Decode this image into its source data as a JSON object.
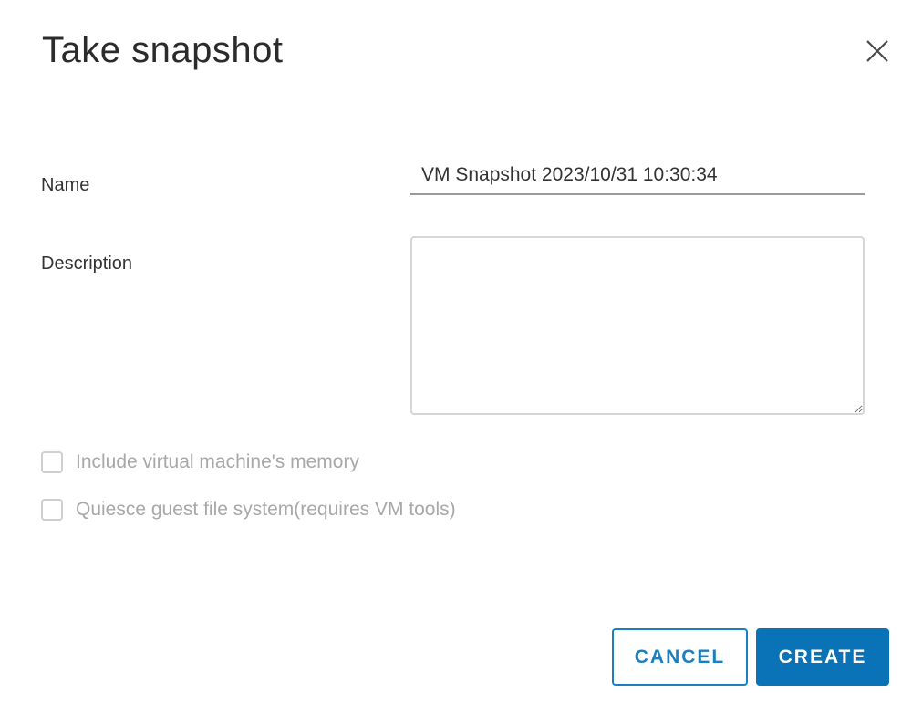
{
  "dialog": {
    "title": "Take snapshot",
    "close_icon": "close-icon"
  },
  "form": {
    "name_label": "Name",
    "name_value": "VM Snapshot 2023/10/31 10:30:34",
    "description_label": "Description",
    "description_value": "",
    "checkboxes": [
      {
        "label": "Include virtual machine's memory",
        "checked": false,
        "disabled": true
      },
      {
        "label": "Quiesce guest file system(requires VM tools)",
        "checked": false,
        "disabled": true
      }
    ]
  },
  "footer": {
    "cancel_label": "CANCEL",
    "create_label": "CREATE"
  },
  "colors": {
    "primary": "#0a72b7",
    "outline": "#1b7fc1",
    "disabled_text": "#a8a8a8"
  }
}
